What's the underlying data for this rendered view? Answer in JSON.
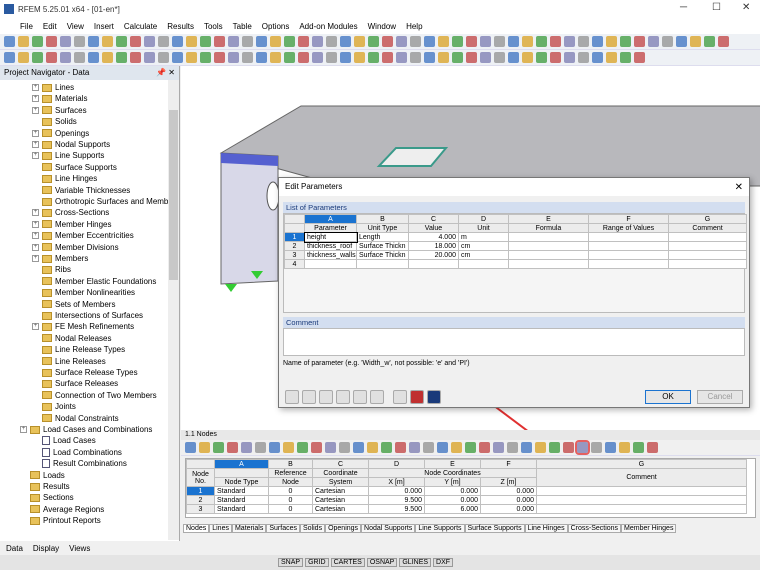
{
  "title": "RFEM 5.25.01 x64 - [01-en*]",
  "menu": [
    "File",
    "Edit",
    "View",
    "Insert",
    "Calculate",
    "Results",
    "Tools",
    "Table",
    "Options",
    "Add-on Modules",
    "Window",
    "Help"
  ],
  "navigator": {
    "title": "Project Navigator - Data",
    "items": [
      {
        "label": "Lines",
        "lvl": 1,
        "exp": true
      },
      {
        "label": "Materials",
        "lvl": 1,
        "exp": true
      },
      {
        "label": "Surfaces",
        "lvl": 1,
        "exp": true
      },
      {
        "label": "Solids",
        "lvl": 1
      },
      {
        "label": "Openings",
        "lvl": 1,
        "exp": true
      },
      {
        "label": "Nodal Supports",
        "lvl": 1,
        "exp": true
      },
      {
        "label": "Line Supports",
        "lvl": 1,
        "exp": true
      },
      {
        "label": "Surface Supports",
        "lvl": 1
      },
      {
        "label": "Line Hinges",
        "lvl": 1
      },
      {
        "label": "Variable Thicknesses",
        "lvl": 1
      },
      {
        "label": "Orthotropic Surfaces and Membra",
        "lvl": 1
      },
      {
        "label": "Cross-Sections",
        "lvl": 1,
        "exp": true
      },
      {
        "label": "Member Hinges",
        "lvl": 1,
        "exp": true
      },
      {
        "label": "Member Eccentricities",
        "lvl": 1,
        "exp": true
      },
      {
        "label": "Member Divisions",
        "lvl": 1,
        "exp": true
      },
      {
        "label": "Members",
        "lvl": 1,
        "exp": true
      },
      {
        "label": "Ribs",
        "lvl": 1
      },
      {
        "label": "Member Elastic Foundations",
        "lvl": 1
      },
      {
        "label": "Member Nonlinearities",
        "lvl": 1
      },
      {
        "label": "Sets of Members",
        "lvl": 1
      },
      {
        "label": "Intersections of Surfaces",
        "lvl": 1
      },
      {
        "label": "FE Mesh Refinements",
        "lvl": 1,
        "exp": true
      },
      {
        "label": "Nodal Releases",
        "lvl": 1
      },
      {
        "label": "Line Release Types",
        "lvl": 1
      },
      {
        "label": "Line Releases",
        "lvl": 1
      },
      {
        "label": "Surface Release Types",
        "lvl": 1
      },
      {
        "label": "Surface Releases",
        "lvl": 1
      },
      {
        "label": "Connection of Two Members",
        "lvl": 1
      },
      {
        "label": "Joints",
        "lvl": 1
      },
      {
        "label": "Nodal Constraints",
        "lvl": 1
      },
      {
        "label": "Load Cases and Combinations",
        "lvl": 0,
        "exp": true
      },
      {
        "label": "Load Cases",
        "lvl": 2,
        "doc": true
      },
      {
        "label": "Load Combinations",
        "lvl": 2,
        "doc": true
      },
      {
        "label": "Result Combinations",
        "lvl": 2,
        "doc": true
      },
      {
        "label": "Loads",
        "lvl": 0
      },
      {
        "label": "Results",
        "lvl": 0
      },
      {
        "label": "Sections",
        "lvl": 0
      },
      {
        "label": "Average Regions",
        "lvl": 0
      },
      {
        "label": "Printout Reports",
        "lvl": 0
      }
    ],
    "tabs": [
      "Data",
      "Display",
      "Views"
    ]
  },
  "dialog": {
    "title": "Edit Parameters",
    "list_title": "List of Parameters",
    "col_letters": [
      "A",
      "B",
      "C",
      "D",
      "E",
      "F",
      "G"
    ],
    "headers": [
      "Parameter",
      "Unit Type",
      "Value",
      "Unit",
      "Formula",
      "Range of Values",
      "Comment"
    ],
    "rows": [
      [
        "1",
        "height",
        "Length",
        "4.000",
        "m"
      ],
      [
        "2",
        "thickness_roof",
        "Surface Thickn",
        "18.000",
        "cm"
      ],
      [
        "3",
        "thickness_walls",
        "Surface Thickn",
        "20.000",
        "cm"
      ],
      [
        "4",
        "",
        "",
        "",
        ""
      ]
    ],
    "comment_label": "Comment",
    "hint": "Name of parameter (e.g. 'Width_w', not possible: 'e' and 'PI')",
    "ok": "OK",
    "cancel": "Cancel"
  },
  "nodes": {
    "title": "1.1 Nodes",
    "col_letters": [
      "A",
      "B",
      "C",
      "D",
      "E",
      "F",
      "G"
    ],
    "h1": [
      "Node No.",
      "",
      "Reference",
      "Coordinate",
      "Node Coordinates",
      "Comment"
    ],
    "h2": [
      "Node Type",
      "Node",
      "System",
      "X [m]",
      "Y [m]",
      "Z [m]"
    ],
    "rows": [
      [
        "1",
        "Standard",
        "0",
        "Cartesian",
        "0.000",
        "0.000",
        "0.000"
      ],
      [
        "2",
        "Standard",
        "0",
        "Cartesian",
        "9.500",
        "0.000",
        "0.000"
      ],
      [
        "3",
        "Standard",
        "0",
        "Cartesian",
        "9.500",
        "6.000",
        "0.000"
      ]
    ],
    "tabs": [
      "Nodes",
      "Lines",
      "Materials",
      "Surfaces",
      "Solids",
      "Openings",
      "Nodal Supports",
      "Line Supports",
      "Surface Supports",
      "Line Hinges",
      "Cross-Sections",
      "Member Hinges"
    ]
  },
  "status": [
    "SNAP",
    "GRID",
    "CARTES",
    "OSNAP",
    "GLINES",
    "DXF"
  ],
  "colors": {
    "accent": "#1a73d0",
    "highlight": "#e03030"
  }
}
